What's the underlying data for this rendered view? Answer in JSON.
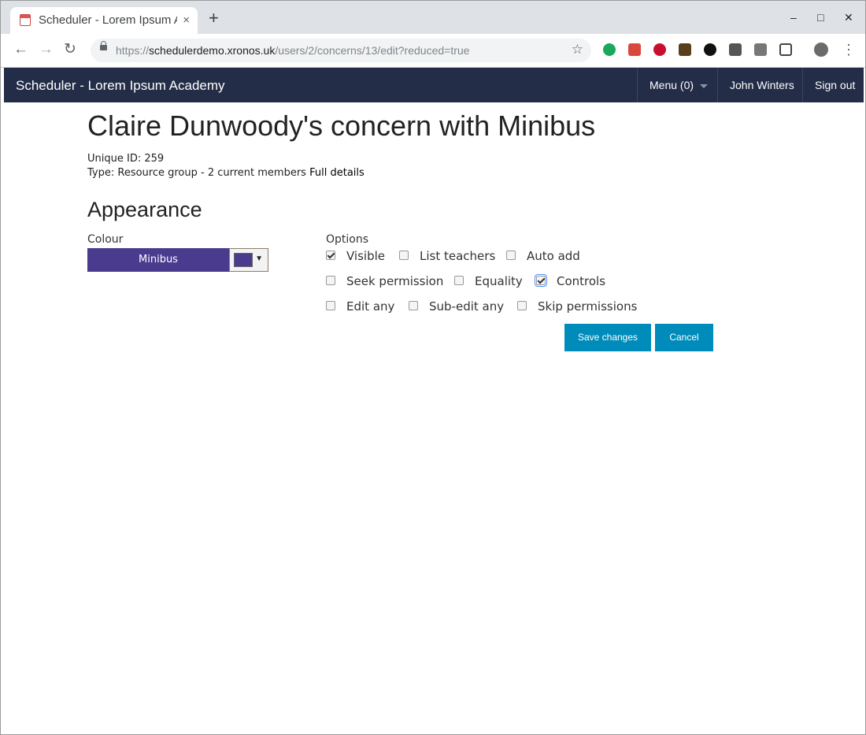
{
  "browser": {
    "tab_title": "Scheduler - Lorem Ipsum Academy",
    "tab_close": "×",
    "new_tab": "+",
    "window_controls": {
      "minimize": "–",
      "maximize": "□",
      "close": "✕"
    },
    "nav": {
      "back": "←",
      "forward": "→",
      "reload": "↻"
    },
    "url": {
      "scheme": "https://",
      "host": "schedulerdemo.xronos.uk",
      "path": "/users/2/concerns/13/edit?reduced=true"
    },
    "bookmark": "☆",
    "menu": "⋮",
    "extension_icons": [
      "evernote-icon",
      "pdf-icon",
      "adblock-plus-icon",
      "home-icon",
      "gnome-icon",
      "lastpass-icon",
      "mail-icon",
      "screenshot-icon",
      "profile-avatar"
    ]
  },
  "app": {
    "brand": "Scheduler - Lorem Ipsum Academy",
    "menu_label": "Menu (0)",
    "user_name": "John Winters",
    "sign_out": "Sign out",
    "navbar_color": "#232d47"
  },
  "page": {
    "title": "Claire Dunwoody's concern with Minibus",
    "unique_id": "Unique ID: 259",
    "type_text": "Type: Resource group - 2 current members",
    "full_details": "Full details",
    "appearance_heading": "Appearance",
    "colour_label": "Colour",
    "colour_swatch_text": "Minibus",
    "colour_value": "#4a3b8f",
    "options_label": "Options",
    "options": [
      {
        "label": "Visible",
        "checked": true
      },
      {
        "label": "List teachers",
        "checked": false
      },
      {
        "label": "Auto add",
        "checked": false
      },
      {
        "label": "Seek permission",
        "checked": false
      },
      {
        "label": "Equality",
        "checked": false
      },
      {
        "label": "Controls",
        "checked": true,
        "focused": true
      },
      {
        "label": "Edit any",
        "checked": false
      },
      {
        "label": "Sub-edit any",
        "checked": false
      },
      {
        "label": "Skip permissions",
        "checked": false
      }
    ],
    "save_button": "Save changes",
    "cancel_button": "Cancel",
    "button_color": "#008cba"
  }
}
